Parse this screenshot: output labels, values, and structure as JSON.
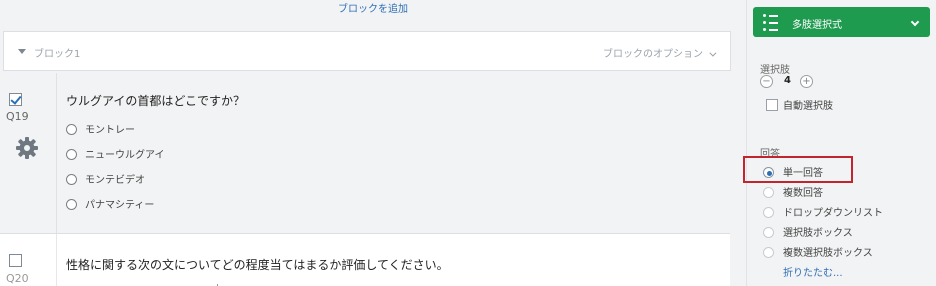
{
  "editor": {
    "add_block": "ブロックを追加",
    "block": {
      "title": "ブロック1",
      "options": "ブロックのオプション"
    },
    "q19": {
      "number": "Q19",
      "text": "ウルグアイの首都はどこですか？",
      "checked": true,
      "choices": [
        "モントレー",
        "ニューウルグアイ",
        "モンテビデオ",
        "パナマシティー"
      ]
    },
    "q20": {
      "number": "Q20",
      "text": "性格に関する次の文についてどの程度当てはまるか評価してください。",
      "checked": false
    }
  },
  "sidebar": {
    "question_type": "多肢選択式",
    "choices_section": "選択肢",
    "choice_count": "4",
    "auto_choices": "自動選択肢",
    "answer_section": "回答",
    "answers": [
      {
        "label": "単一回答",
        "selected": true
      },
      {
        "label": "複数回答",
        "selected": false
      },
      {
        "label": "ドロップダウンリスト",
        "selected": false
      },
      {
        "label": "選択肢ボックス",
        "selected": false
      },
      {
        "label": "複数選択肢ボックス",
        "selected": false
      }
    ],
    "collapse": "折りたたむ...",
    "colors": {
      "accent": "#1f9b50",
      "link": "#2f6fb5",
      "highlight": "#c0262d"
    }
  }
}
